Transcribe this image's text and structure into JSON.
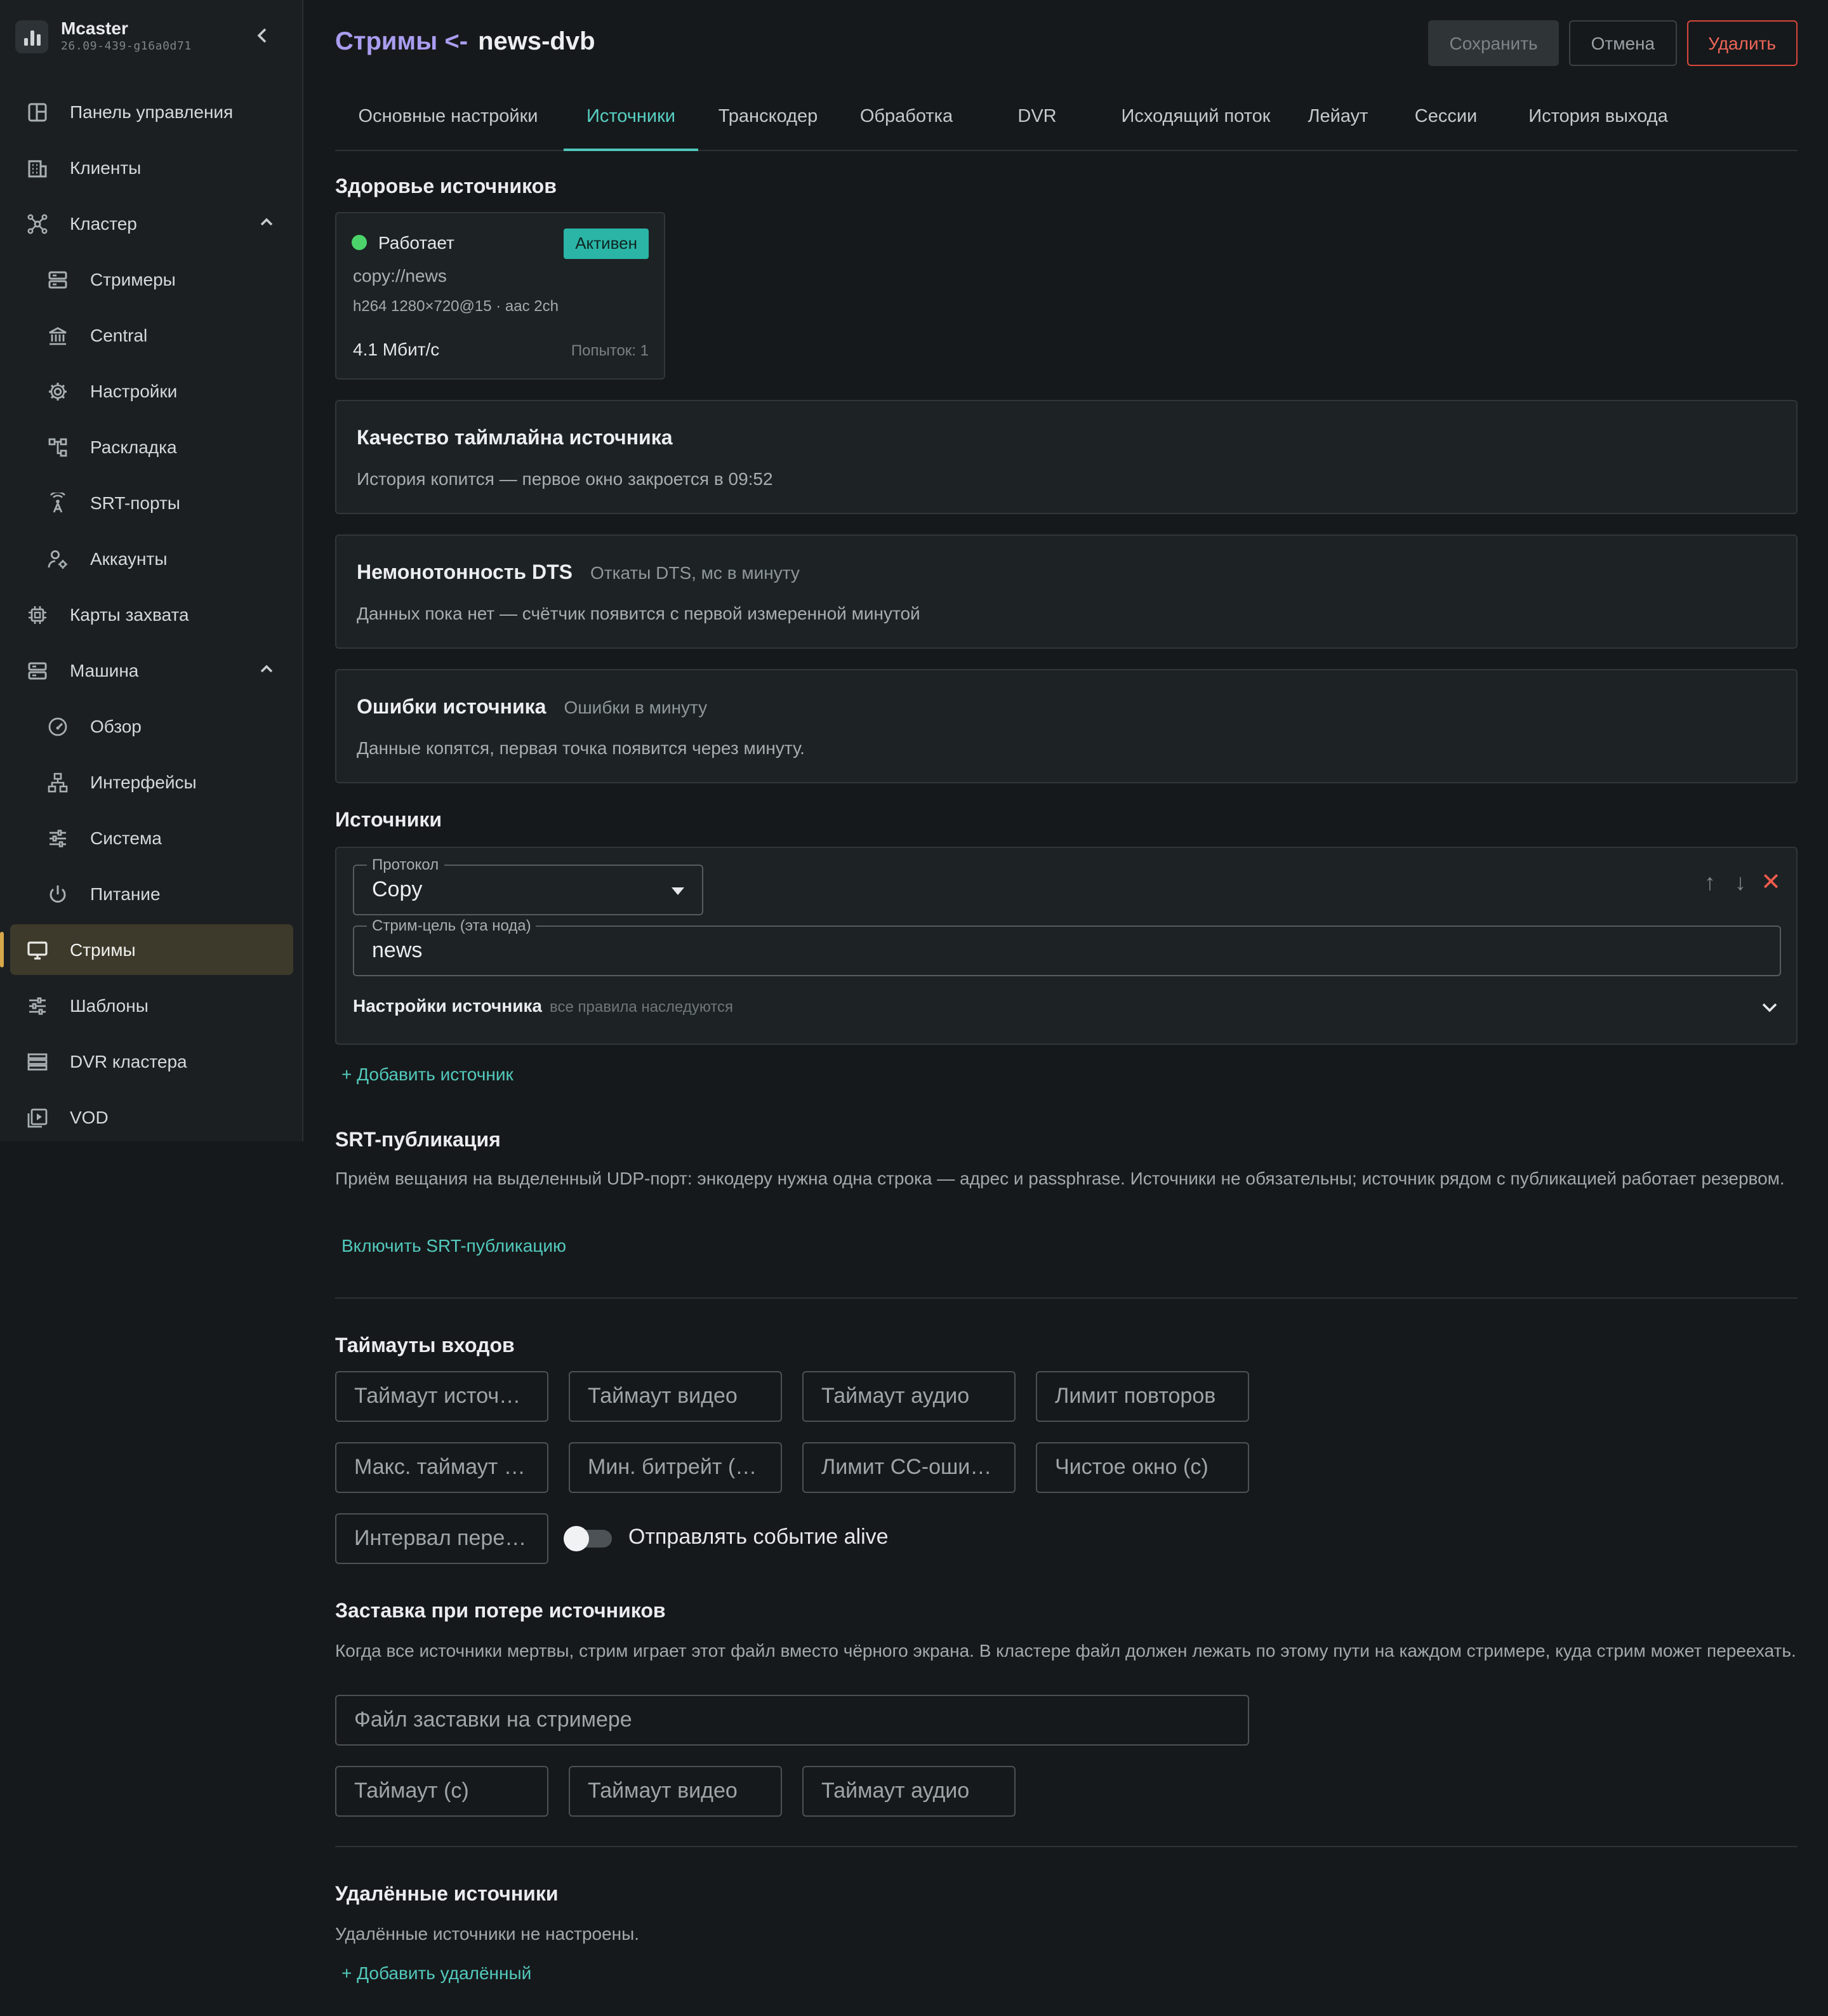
{
  "app": {
    "name": "Mcaster",
    "version": "26.09-439-g16a0d71"
  },
  "sidebar": {
    "items": [
      {
        "label": "Панель управления",
        "icon": "dashboard-icon",
        "level": "top"
      },
      {
        "label": "Клиенты",
        "icon": "building-icon",
        "level": "top"
      },
      {
        "label": "Кластер",
        "icon": "cluster-icon",
        "level": "top",
        "expanded": true
      },
      {
        "label": "Стримеры",
        "icon": "server-icon",
        "level": "sub"
      },
      {
        "label": "Central",
        "icon": "bank-icon",
        "level": "sub"
      },
      {
        "label": "Настройки",
        "icon": "gear-icon",
        "level": "sub"
      },
      {
        "label": "Раскладка",
        "icon": "layout-icon",
        "level": "sub"
      },
      {
        "label": "SRT-порты",
        "icon": "antenna-icon",
        "level": "sub"
      },
      {
        "label": "Аккаунты",
        "icon": "user-cog-icon",
        "level": "sub"
      },
      {
        "label": "Карты захвата",
        "icon": "chip-icon",
        "level": "top"
      },
      {
        "label": "Машина",
        "icon": "server-icon",
        "level": "top",
        "expanded": true
      },
      {
        "label": "Обзор",
        "icon": "gauge-icon",
        "level": "sub"
      },
      {
        "label": "Интерфейсы",
        "icon": "network-icon",
        "level": "sub"
      },
      {
        "label": "Система",
        "icon": "sliders-icon",
        "level": "sub"
      },
      {
        "label": "Питание",
        "icon": "power-icon",
        "level": "sub"
      },
      {
        "label": "Стримы",
        "icon": "monitor-icon",
        "level": "top",
        "active": true
      },
      {
        "label": "Шаблоны",
        "icon": "sliders-icon",
        "level": "top"
      },
      {
        "label": "DVR кластера",
        "icon": "storage-icon",
        "level": "top"
      },
      {
        "label": "VOD",
        "icon": "video-library-icon",
        "level": "top"
      }
    ]
  },
  "header": {
    "crumb": "Стримы <-",
    "stream_name": "news-dvb",
    "save_label": "Сохранить",
    "cancel_label": "Отмена",
    "delete_label": "Удалить"
  },
  "tabs": [
    {
      "label": "Основные настройки"
    },
    {
      "label": "Источники",
      "active": true
    },
    {
      "label": "Транскодер"
    },
    {
      "label": "Обработка"
    },
    {
      "label": "DVR"
    },
    {
      "label": "Исходящий поток"
    },
    {
      "label": "Лейаут"
    },
    {
      "label": "Сессии"
    },
    {
      "label": "История выхода"
    }
  ],
  "health": {
    "title": "Здоровье источников",
    "status": "Работает",
    "badge": "Активен",
    "url": "copy://news",
    "meta": "h264 1280×720@15 · aac 2ch",
    "bitrate": "4.1 Мбит/с",
    "attempts": "Попыток: 1",
    "status_color": "#4cd46a",
    "badge_color": "#2ab5a6"
  },
  "panels": {
    "timeline": {
      "title": "Качество таймлайна источника",
      "desc": "История копится — первое окно закроется в 09:52"
    },
    "dts": {
      "title": "Немонотонность DTS",
      "subtitle": "Откаты DTS, мс в минуту",
      "desc": "Данных пока нет — счётчик появится с первой измеренной минутой"
    },
    "errors": {
      "title": "Ошибки источника",
      "subtitle": "Ошибки в минуту",
      "desc": "Данные копятся, первая точка появится через минуту."
    }
  },
  "sources": {
    "title": "Источники",
    "protocol_label": "Протокол",
    "protocol_value": "Copy",
    "target_label": "Стрим-цель (эта нода)",
    "target_value": "news",
    "settings_label": "Настройки источника",
    "settings_hint": "все правила наследуются",
    "add_label": "+ Добавить источник"
  },
  "srt": {
    "title": "SRT-публикация",
    "desc": "Приём вещания на выделенный UDP-порт: энкодеру нужна одна строка — адрес и passphrase. Источники не обязательны; источник рядом с публикацией работает резервом.",
    "enable_label": "Включить SRT-публикацию"
  },
  "timeouts": {
    "title": "Таймауты входов",
    "fields": [
      "Таймаут источника (с)",
      "Таймаут видео",
      "Таймаут аудио",
      "Лимит повторов",
      "Макс. таймаут переподключения",
      "Мин. битрейт (Кбит/с)",
      "Лимит CC-ошибок",
      "Чистое окно (с)",
      "Интервал переподключения"
    ],
    "alive_label": "Отправлять событие alive",
    "alive_on": false
  },
  "fallback": {
    "title": "Заставка при потере источников",
    "desc": "Когда все источники мертвы, стрим играет этот файл вместо чёрного экрана. В кластере файл должен лежать по этому пути на каждом стримере, куда стрим может переехать.",
    "file_placeholder": "Файл заставки на стримере",
    "timeout_placeholder": "Таймаут (с)",
    "video_placeholder": "Таймаут видео",
    "audio_placeholder": "Таймаут аудио"
  },
  "remote": {
    "title": "Удалённые источники",
    "desc": "Удалённые источники не настроены.",
    "add_label": "+ Добавить удалённый"
  }
}
